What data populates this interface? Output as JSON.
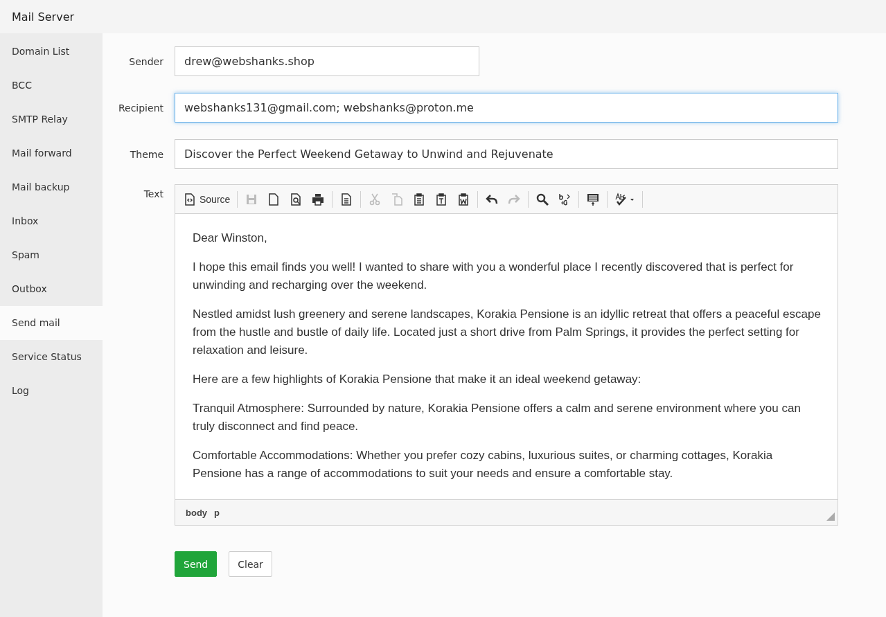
{
  "window": {
    "title": "Mail Server"
  },
  "sidebar": {
    "items": [
      {
        "label": "Domain List",
        "selected": false
      },
      {
        "label": "BCC",
        "selected": false
      },
      {
        "label": "SMTP Relay",
        "selected": false
      },
      {
        "label": "Mail forward",
        "selected": false
      },
      {
        "label": "Mail backup",
        "selected": false
      },
      {
        "label": "Inbox",
        "selected": false
      },
      {
        "label": "Spam",
        "selected": false
      },
      {
        "label": "Outbox",
        "selected": false
      },
      {
        "label": "Send mail",
        "selected": true
      },
      {
        "label": "Service Status",
        "selected": false
      },
      {
        "label": "Log",
        "selected": false
      }
    ]
  },
  "form": {
    "sender": {
      "label": "Sender",
      "value": "drew@webshanks.shop"
    },
    "recipient": {
      "label": "Recipient",
      "value": "webshanks131@gmail.com; webshanks@proton.me",
      "focused": true
    },
    "theme": {
      "label": "Theme",
      "value": "Discover the Perfect Weekend Getaway to Unwind and Rejuvenate"
    },
    "text_label": "Text"
  },
  "editor": {
    "toolbar": [
      {
        "kind": "source",
        "label": "Source",
        "disabled": false
      },
      {
        "kind": "separator"
      },
      {
        "kind": "save",
        "disabled": true
      },
      {
        "kind": "new-page",
        "disabled": false
      },
      {
        "kind": "preview",
        "disabled": false
      },
      {
        "kind": "print",
        "disabled": false
      },
      {
        "kind": "separator"
      },
      {
        "kind": "templates",
        "disabled": false
      },
      {
        "kind": "separator"
      },
      {
        "kind": "cut",
        "disabled": true
      },
      {
        "kind": "copy",
        "disabled": true
      },
      {
        "kind": "paste",
        "disabled": false
      },
      {
        "kind": "paste-text",
        "disabled": false
      },
      {
        "kind": "paste-word",
        "disabled": false
      },
      {
        "kind": "separator"
      },
      {
        "kind": "undo",
        "disabled": false
      },
      {
        "kind": "redo",
        "disabled": true
      },
      {
        "kind": "separator"
      },
      {
        "kind": "find",
        "disabled": false
      },
      {
        "kind": "replace",
        "disabled": false
      },
      {
        "kind": "separator"
      },
      {
        "kind": "show-blocks",
        "disabled": false
      },
      {
        "kind": "separator"
      },
      {
        "kind": "spellcheck",
        "disabled": false
      },
      {
        "kind": "separator"
      }
    ],
    "paragraphs": [
      "Dear Winston,",
      "I hope this email finds you well! I wanted to share with you a wonderful place I recently discovered that is perfect for unwinding and recharging over the weekend.",
      "Nestled amidst lush greenery and serene landscapes, Korakia Pensione is an idyllic retreat that offers a peaceful escape from the hustle and bustle of daily life. Located just a short drive from Palm Springs, it provides the perfect setting for relaxation and leisure.",
      "Here are a few highlights of Korakia Pensione that make it an ideal weekend getaway:",
      "Tranquil Atmosphere: Surrounded by nature, Korakia Pensione offers a calm and serene environment where you can truly disconnect and find peace.",
      "Comfortable Accommodations: Whether you prefer cozy cabins, luxurious suites, or charming cottages, Korakia Pensione has a range of accommodations to suit your needs and ensure a comfortable stay."
    ],
    "path": [
      "body",
      "p"
    ]
  },
  "buttons": [
    {
      "kind": "primary",
      "label": "Send"
    },
    {
      "kind": "default",
      "label": "Clear"
    }
  ]
}
